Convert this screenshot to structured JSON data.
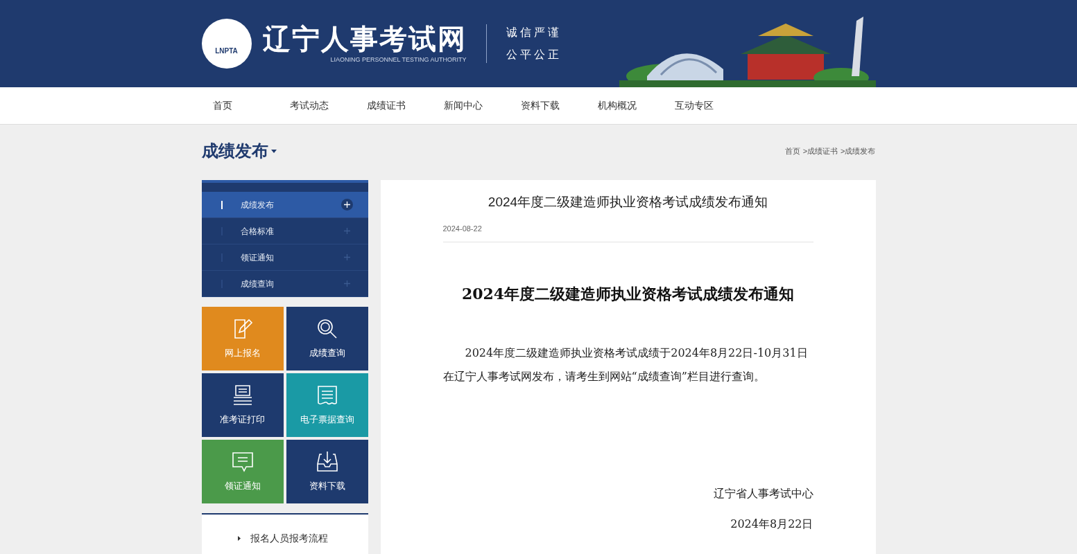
{
  "header": {
    "logo_text": "LNPTA",
    "title": "辽宁人事考试网",
    "subtitle": "LIAONING PERSONNEL TESTING AUTHORITY",
    "motto": [
      "诚信严谨",
      "公平公正"
    ]
  },
  "nav": [
    {
      "label": "首页"
    },
    {
      "label": "考试动态"
    },
    {
      "label": "成绩证书"
    },
    {
      "label": "新闻中心"
    },
    {
      "label": "资料下载"
    },
    {
      "label": "机构概况"
    },
    {
      "label": "互动专区"
    }
  ],
  "page_title": "成绩发布",
  "breadcrumb": [
    {
      "label": "首页"
    },
    {
      "separator": ">",
      "label": "成绩证书"
    },
    {
      "separator": ">",
      "label": "成绩发布"
    }
  ],
  "side_menu": [
    {
      "label": "成绩发布",
      "selected": true
    },
    {
      "label": "合格标准",
      "selected": false
    },
    {
      "label": "领证通知",
      "selected": false
    },
    {
      "label": "成绩查询",
      "selected": false
    }
  ],
  "tiles": [
    {
      "label": "网上报名",
      "kind": "edit",
      "color": "#e08a1e"
    },
    {
      "label": "成绩查询",
      "kind": "search",
      "color": "#1e3a6e"
    },
    {
      "label": "准考证打印",
      "kind": "print",
      "color": "#1e3a6e"
    },
    {
      "label": "电子票据查询",
      "kind": "receipt",
      "color": "#1a9aa5"
    },
    {
      "label": "领证通知",
      "kind": "message",
      "color": "#4b9a4a"
    },
    {
      "label": "资料下载",
      "kind": "download",
      "color": "#1e3a6e"
    }
  ],
  "links": [
    {
      "label": "报名人员报考流程"
    }
  ],
  "article": {
    "title": "2024年度二级建造师执业资格考试成绩发布通知",
    "date": "2024-08-22",
    "heading": "2024年度二级建造师执业资格考试成绩发布通知",
    "body": "2024年度二级建造师执业资格考试成绩于2024年8月22日-10月31日在辽宁人事考试网发布，请考生到网站“成绩查询”栏目进行查询。",
    "signature": "辽宁省人事考试中心",
    "sign_date": "2024年8月22日"
  }
}
